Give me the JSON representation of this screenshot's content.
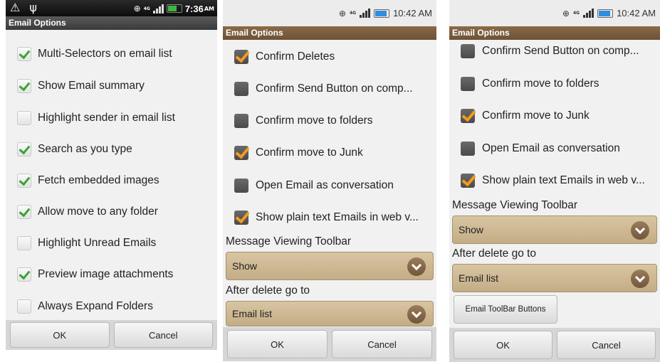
{
  "screens": [
    {
      "status": {
        "left_icons": "⚠ ψ",
        "right_glyph": "⊕",
        "network": "4G",
        "time": "7:36",
        "ampm": "AM"
      },
      "title": "Email Options",
      "items": [
        {
          "label": "Multi-Selectors on email list",
          "checked": true
        },
        {
          "label": "Show Email summary",
          "checked": true
        },
        {
          "label": "Highlight sender in email list",
          "checked": false
        },
        {
          "label": "Search as you type",
          "checked": true
        },
        {
          "label": "Fetch embedded images",
          "checked": true
        },
        {
          "label": "Allow move to any folder",
          "checked": true
        },
        {
          "label": "Highlight Unread Emails",
          "checked": false
        },
        {
          "label": "Preview image attachments",
          "checked": true
        },
        {
          "label": "Always Expand Folders",
          "checked": false
        }
      ],
      "buttons": {
        "ok": "OK",
        "cancel": "Cancel"
      }
    },
    {
      "status": {
        "right_glyph": "⊕",
        "network": "4G",
        "time": "10:42 AM"
      },
      "title": "Email Options",
      "items": [
        {
          "label": "Confirm Deletes",
          "checked": true
        },
        {
          "label": "Confirm Send Button on comp...",
          "checked": false
        },
        {
          "label": "Confirm move to folders",
          "checked": false
        },
        {
          "label": "Confirm move to Junk",
          "checked": true
        },
        {
          "label": "Open Email as conversation",
          "checked": false
        },
        {
          "label": "Show plain text Emails in web v...",
          "checked": true
        }
      ],
      "viewing_toolbar": {
        "caption": "Message Viewing Toolbar",
        "value": "Show"
      },
      "after_delete": {
        "caption": "After delete go to",
        "value": "Email list"
      },
      "buttons": {
        "ok": "OK",
        "cancel": "Cancel"
      }
    },
    {
      "status": {
        "right_glyph": "⊕",
        "network": "4G",
        "time": "10:42 AM"
      },
      "title": "Email Options",
      "items": [
        {
          "label": "Confirm Send Button on comp...",
          "checked": false
        },
        {
          "label": "Confirm move to folders",
          "checked": false
        },
        {
          "label": "Confirm move to Junk",
          "checked": true
        },
        {
          "label": "Open Email as conversation",
          "checked": false
        },
        {
          "label": "Show plain text Emails in web v...",
          "checked": true
        }
      ],
      "viewing_toolbar": {
        "caption": "Message Viewing Toolbar",
        "value": "Show"
      },
      "after_delete": {
        "caption": "After delete go to",
        "value": "Email list"
      },
      "toolbar_buttons_label": "Email ToolBar Buttons",
      "buttons": {
        "ok": "OK",
        "cancel": "Cancel"
      }
    }
  ]
}
